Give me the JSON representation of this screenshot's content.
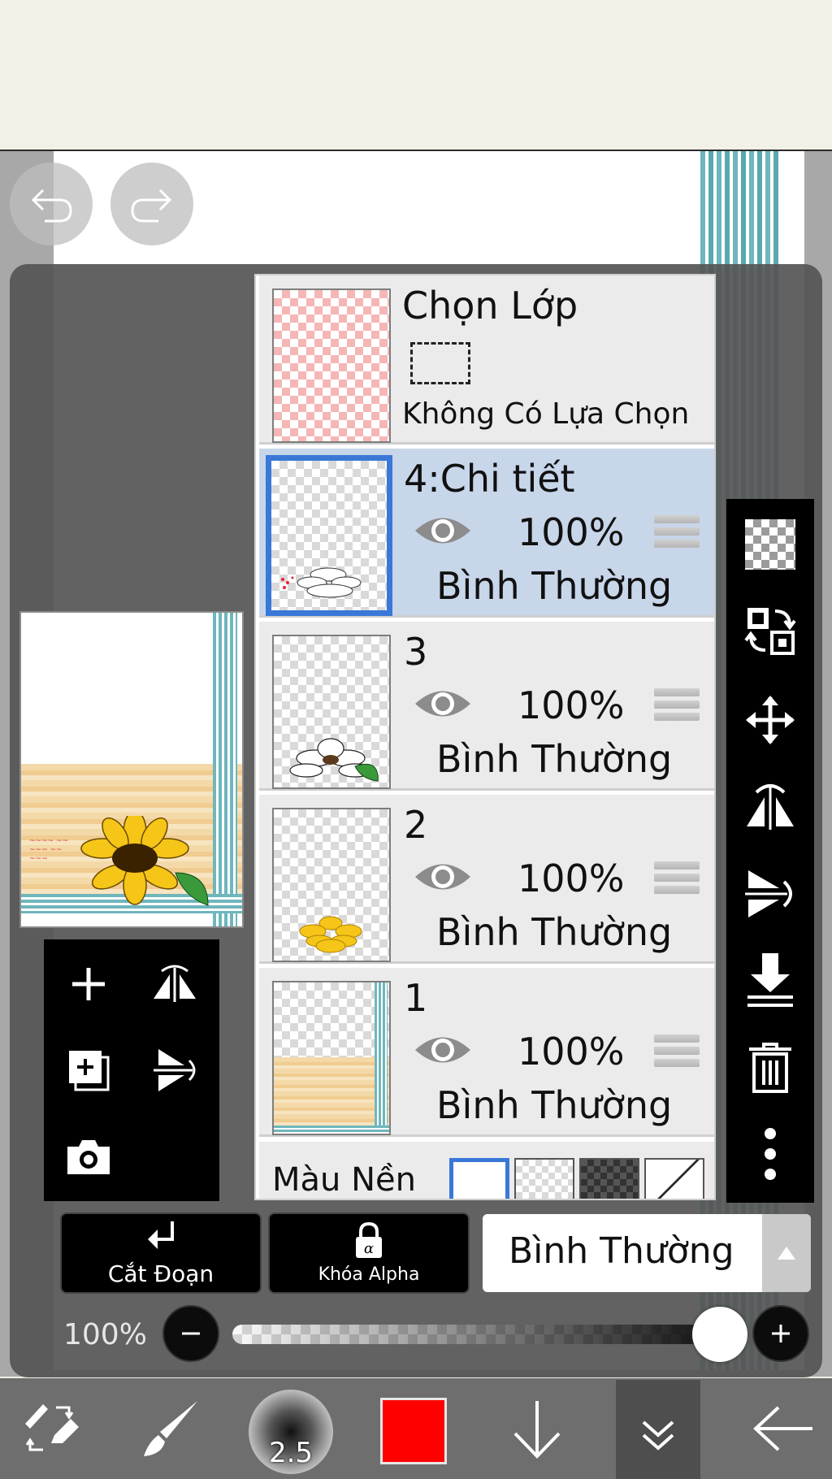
{
  "layer_panel": {
    "selection_layer": {
      "title": "Chọn Lớp",
      "status": "Không Có Lựa Chọn"
    },
    "layers": [
      {
        "name": "4:Chi tiết",
        "opacity": "100%",
        "blend": "Bình Thường",
        "selected": true
      },
      {
        "name": "3",
        "opacity": "100%",
        "blend": "Bình Thường",
        "selected": false
      },
      {
        "name": "2",
        "opacity": "100%",
        "blend": "Bình Thường",
        "selected": false
      },
      {
        "name": "1",
        "opacity": "100%",
        "blend": "Bình Thường",
        "selected": false
      }
    ],
    "background_label": "Màu Nền"
  },
  "controls": {
    "clipping_label": "Cắt Đoạn",
    "alpha_lock_label": "Khóa Alpha",
    "blend_mode": "Bình Thường",
    "opacity_label": "100%",
    "opacity_value": 1.0
  },
  "bottom_bar": {
    "brush_size": "2.5",
    "current_color": "#ff0000"
  },
  "colors": {
    "selected_layer_bg": "#c8d6ea",
    "selected_border": "#3a78d8",
    "panel_bg": "#ebebeb",
    "toolbar_bg": "#000000",
    "bottom_bar_bg": "#6e6e6e"
  }
}
